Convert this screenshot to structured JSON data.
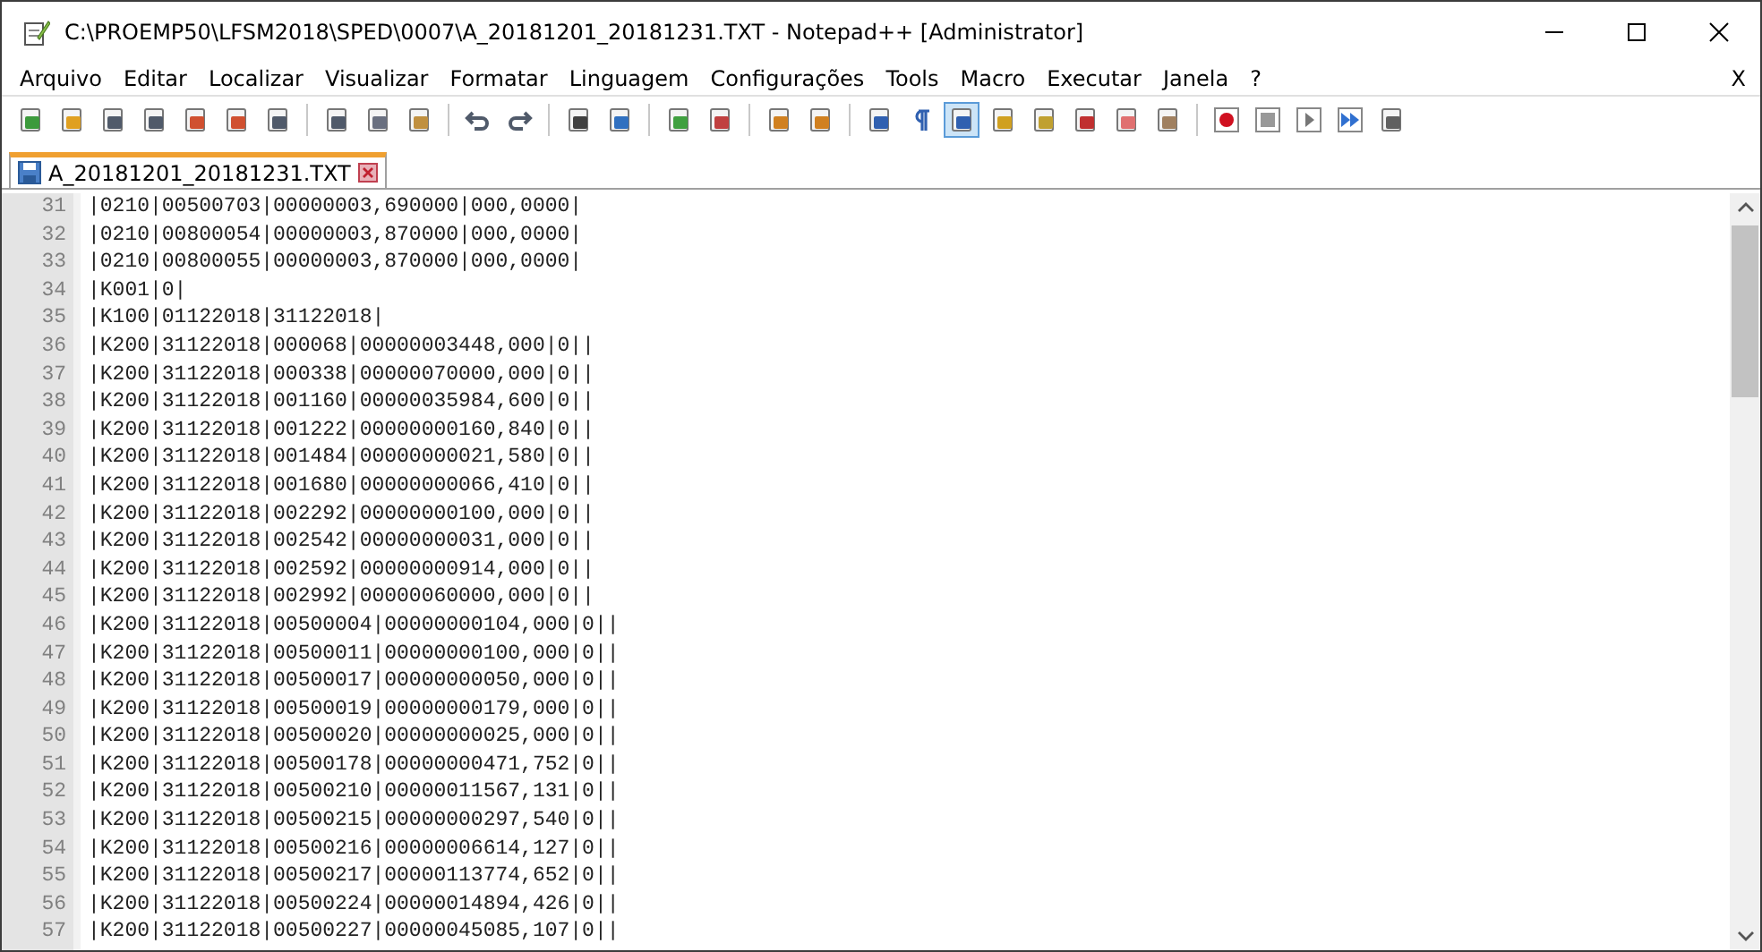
{
  "window": {
    "title": "C:\\PROEMP50\\LFSM2018\\SPED\\0007\\A_20181201_20181231.TXT - Notepad++ [Administrator]"
  },
  "menu": [
    "Arquivo",
    "Editar",
    "Localizar",
    "Visualizar",
    "Formatar",
    "Linguagem",
    "Configurações",
    "Tools",
    "Macro",
    "Executar",
    "Janela",
    "?"
  ],
  "menu_close": "X",
  "toolbar": [
    {
      "kind": "button",
      "selected": false
    },
    {
      "kind": "button",
      "selected": false
    },
    {
      "kind": "button",
      "selected": false
    },
    {
      "kind": "button",
      "selected": false
    },
    {
      "kind": "button",
      "selected": false
    },
    {
      "kind": "button",
      "selected": false
    },
    {
      "kind": "button",
      "selected": false
    },
    {
      "kind": "separator"
    },
    {
      "kind": "button",
      "selected": false
    },
    {
      "kind": "button",
      "selected": false
    },
    {
      "kind": "button",
      "selected": false
    },
    {
      "kind": "separator"
    },
    {
      "kind": "button",
      "selected": false
    },
    {
      "kind": "button",
      "selected": false
    },
    {
      "kind": "separator"
    },
    {
      "kind": "button",
      "selected": false
    },
    {
      "kind": "button",
      "selected": false
    },
    {
      "kind": "separator"
    },
    {
      "kind": "button",
      "selected": false
    },
    {
      "kind": "button",
      "selected": false
    },
    {
      "kind": "separator"
    },
    {
      "kind": "button",
      "selected": false
    },
    {
      "kind": "button",
      "selected": false
    },
    {
      "kind": "separator"
    },
    {
      "kind": "button",
      "selected": false
    },
    {
      "kind": "button",
      "selected": false
    },
    {
      "kind": "button",
      "selected": true
    },
    {
      "kind": "button",
      "selected": false
    },
    {
      "kind": "button",
      "selected": false
    },
    {
      "kind": "button",
      "selected": false
    },
    {
      "kind": "button",
      "selected": false
    },
    {
      "kind": "button",
      "selected": false
    },
    {
      "kind": "separator"
    },
    {
      "kind": "button",
      "selected": false
    },
    {
      "kind": "button",
      "selected": false
    },
    {
      "kind": "button",
      "selected": false
    },
    {
      "kind": "button",
      "selected": false
    },
    {
      "kind": "button",
      "selected": false
    }
  ],
  "tabs": [
    {
      "label": "A_20181201_20181231.TXT",
      "selected": true
    }
  ],
  "lines": [
    {
      "number": "31",
      "text": "|0210|00500703|00000003,690000|000,0000|"
    },
    {
      "number": "32",
      "text": "|0210|00800054|00000003,870000|000,0000|"
    },
    {
      "number": "33",
      "text": "|0210|00800055|00000003,870000|000,0000|"
    },
    {
      "number": "34",
      "text": "|K001|0|"
    },
    {
      "number": "35",
      "text": "|K100|01122018|31122018|"
    },
    {
      "number": "36",
      "text": "|K200|31122018|000068|00000003448,000|0||"
    },
    {
      "number": "37",
      "text": "|K200|31122018|000338|00000070000,000|0||"
    },
    {
      "number": "38",
      "text": "|K200|31122018|001160|00000035984,600|0||"
    },
    {
      "number": "39",
      "text": "|K200|31122018|001222|00000000160,840|0||"
    },
    {
      "number": "40",
      "text": "|K200|31122018|001484|00000000021,580|0||"
    },
    {
      "number": "41",
      "text": "|K200|31122018|001680|00000000066,410|0||"
    },
    {
      "number": "42",
      "text": "|K200|31122018|002292|00000000100,000|0||"
    },
    {
      "number": "43",
      "text": "|K200|31122018|002542|00000000031,000|0||"
    },
    {
      "number": "44",
      "text": "|K200|31122018|002592|00000000914,000|0||"
    },
    {
      "number": "45",
      "text": "|K200|31122018|002992|00000060000,000|0||"
    },
    {
      "number": "46",
      "text": "|K200|31122018|00500004|00000000104,000|0||"
    },
    {
      "number": "47",
      "text": "|K200|31122018|00500011|00000000100,000|0||"
    },
    {
      "number": "48",
      "text": "|K200|31122018|00500017|00000000050,000|0||"
    },
    {
      "number": "49",
      "text": "|K200|31122018|00500019|00000000179,000|0||"
    },
    {
      "number": "50",
      "text": "|K200|31122018|00500020|00000000025,000|0||"
    },
    {
      "number": "51",
      "text": "|K200|31122018|00500178|00000000471,752|0||"
    },
    {
      "number": "52",
      "text": "|K200|31122018|00500210|00000011567,131|0||"
    },
    {
      "number": "53",
      "text": "|K200|31122018|00500215|00000000297,540|0||"
    },
    {
      "number": "54",
      "text": "|K200|31122018|00500216|00000006614,127|0||"
    },
    {
      "number": "55",
      "text": "|K200|31122018|00500217|00000113774,652|0||"
    },
    {
      "number": "56",
      "text": "|K200|31122018|00500224|00000014894,426|0||"
    },
    {
      "number": "57",
      "text": "|K200|31122018|00500227|00000045085,107|0||"
    }
  ]
}
